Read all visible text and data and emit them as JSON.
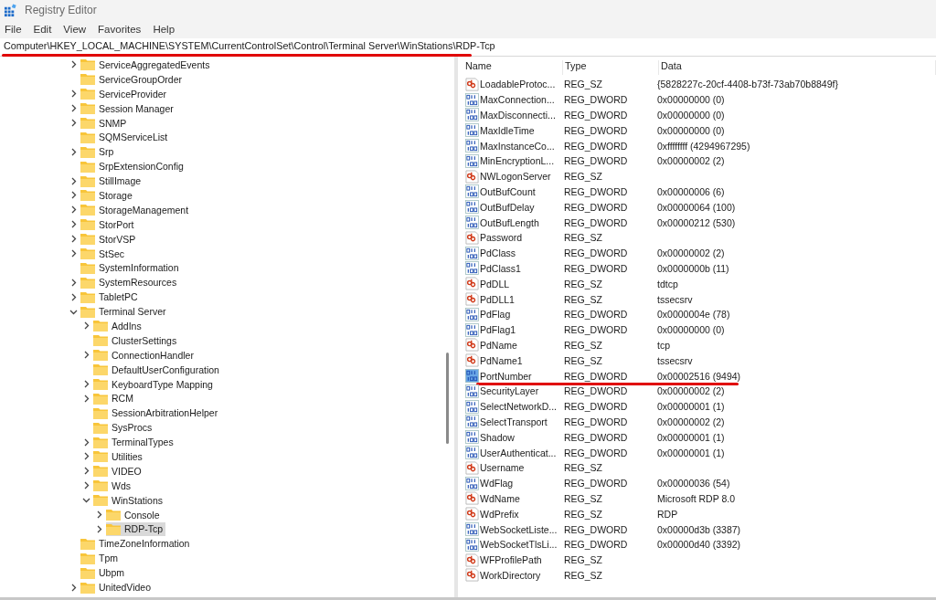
{
  "window": {
    "title": "Registry Editor"
  },
  "menu": [
    "File",
    "Edit",
    "View",
    "Favorites",
    "Help"
  ],
  "address": {
    "value": "Computer\\HKEY_LOCAL_MACHINE\\SYSTEM\\CurrentControlSet\\Control\\Terminal Server\\WinStations\\RDP-Tcp",
    "underlined": true
  },
  "tree": [
    {
      "label": "ServiceAggregatedEvents",
      "kind": "branch",
      "expanded": false,
      "selected": false
    },
    {
      "label": "ServiceGroupOrder",
      "kind": "leaf",
      "selected": false
    },
    {
      "label": "ServiceProvider",
      "kind": "branch",
      "expanded": false,
      "selected": false
    },
    {
      "label": "Session Manager",
      "kind": "branch",
      "expanded": false,
      "selected": false
    },
    {
      "label": "SNMP",
      "kind": "branch",
      "expanded": false,
      "selected": false
    },
    {
      "label": "SQMServiceList",
      "kind": "leaf",
      "selected": false
    },
    {
      "label": "Srp",
      "kind": "branch",
      "expanded": false,
      "selected": false
    },
    {
      "label": "SrpExtensionConfig",
      "kind": "leaf",
      "selected": false
    },
    {
      "label": "StillImage",
      "kind": "branch",
      "expanded": false,
      "selected": false
    },
    {
      "label": "Storage",
      "kind": "branch",
      "expanded": false,
      "selected": false
    },
    {
      "label": "StorageManagement",
      "kind": "branch",
      "expanded": false,
      "selected": false
    },
    {
      "label": "StorPort",
      "kind": "branch",
      "expanded": false,
      "selected": false
    },
    {
      "label": "StorVSP",
      "kind": "branch",
      "expanded": false,
      "selected": false
    },
    {
      "label": "StSec",
      "kind": "branch",
      "expanded": false,
      "selected": false
    },
    {
      "label": "SystemInformation",
      "kind": "leaf",
      "selected": false
    },
    {
      "label": "SystemResources",
      "kind": "branch",
      "expanded": false,
      "selected": false
    },
    {
      "label": "TabletPC",
      "kind": "branch",
      "expanded": false,
      "selected": false
    },
    {
      "label": "Terminal Server",
      "kind": "branch",
      "expanded": true,
      "selected": false,
      "children": [
        {
          "label": "AddIns",
          "kind": "branch",
          "expanded": false,
          "selected": false
        },
        {
          "label": "ClusterSettings",
          "kind": "leaf",
          "selected": false
        },
        {
          "label": "ConnectionHandler",
          "kind": "branch",
          "expanded": false,
          "selected": false
        },
        {
          "label": "DefaultUserConfiguration",
          "kind": "leaf",
          "selected": false
        },
        {
          "label": "KeyboardType Mapping",
          "kind": "branch",
          "expanded": false,
          "selected": false
        },
        {
          "label": "RCM",
          "kind": "branch",
          "expanded": false,
          "selected": false
        },
        {
          "label": "SessionArbitrationHelper",
          "kind": "leaf",
          "selected": false
        },
        {
          "label": "SysProcs",
          "kind": "leaf",
          "selected": false
        },
        {
          "label": "TerminalTypes",
          "kind": "branch",
          "expanded": false,
          "selected": false
        },
        {
          "label": "Utilities",
          "kind": "branch",
          "expanded": false,
          "selected": false
        },
        {
          "label": "VIDEO",
          "kind": "branch",
          "expanded": false,
          "selected": false
        },
        {
          "label": "Wds",
          "kind": "branch",
          "expanded": false,
          "selected": false
        },
        {
          "label": "WinStations",
          "kind": "branch",
          "expanded": true,
          "selected": false,
          "children": [
            {
              "label": "Console",
              "kind": "branch",
              "expanded": false,
              "selected": false
            },
            {
              "label": "RDP-Tcp",
              "kind": "branch",
              "expanded": false,
              "selected": true
            }
          ]
        }
      ]
    },
    {
      "label": "TimeZoneInformation",
      "kind": "leaf",
      "selected": false
    },
    {
      "label": "Tpm",
      "kind": "leaf",
      "selected": false
    },
    {
      "label": "Ubpm",
      "kind": "leaf",
      "selected": false
    },
    {
      "label": "UnitedVideo",
      "kind": "branch",
      "expanded": false,
      "selected": false
    }
  ],
  "values": {
    "columns": [
      "Name",
      "Type",
      "Data"
    ],
    "rows": [
      {
        "name": "LoadableProtoc...",
        "type": "REG_SZ",
        "data": "{5828227c-20cf-4408-b73f-73ab70b8849f}",
        "kind": "sz",
        "selected": false,
        "underlined": false
      },
      {
        "name": "MaxConnection...",
        "type": "REG_DWORD",
        "data": "0x00000000 (0)",
        "kind": "dword",
        "selected": false,
        "underlined": false
      },
      {
        "name": "MaxDisconnecti...",
        "type": "REG_DWORD",
        "data": "0x00000000 (0)",
        "kind": "dword",
        "selected": false,
        "underlined": false
      },
      {
        "name": "MaxIdleTime",
        "type": "REG_DWORD",
        "data": "0x00000000 (0)",
        "kind": "dword",
        "selected": false,
        "underlined": false
      },
      {
        "name": "MaxInstanceCo...",
        "type": "REG_DWORD",
        "data": "0xffffffff (4294967295)",
        "kind": "dword",
        "selected": false,
        "underlined": false
      },
      {
        "name": "MinEncryptionL...",
        "type": "REG_DWORD",
        "data": "0x00000002 (2)",
        "kind": "dword",
        "selected": false,
        "underlined": false
      },
      {
        "name": "NWLogonServer",
        "type": "REG_SZ",
        "kind": "sz",
        "selected": false,
        "underlined": false
      },
      {
        "name": "OutBufCount",
        "type": "REG_DWORD",
        "data": "0x00000006 (6)",
        "kind": "dword",
        "selected": false,
        "underlined": false
      },
      {
        "name": "OutBufDelay",
        "type": "REG_DWORD",
        "data": "0x00000064 (100)",
        "kind": "dword",
        "selected": false,
        "underlined": false
      },
      {
        "name": "OutBufLength",
        "type": "REG_DWORD",
        "data": "0x00000212 (530)",
        "kind": "dword",
        "selected": false,
        "underlined": false
      },
      {
        "name": "Password",
        "type": "REG_SZ",
        "kind": "sz",
        "selected": false,
        "underlined": false
      },
      {
        "name": "PdClass",
        "type": "REG_DWORD",
        "data": "0x00000002 (2)",
        "kind": "dword",
        "selected": false,
        "underlined": false
      },
      {
        "name": "PdClass1",
        "type": "REG_DWORD",
        "data": "0x0000000b (11)",
        "kind": "dword",
        "selected": false,
        "underlined": false
      },
      {
        "name": "PdDLL",
        "type": "REG_SZ",
        "data": "tdtcp",
        "kind": "sz",
        "selected": false,
        "underlined": false
      },
      {
        "name": "PdDLL1",
        "type": "REG_SZ",
        "data": "tssecsrv",
        "kind": "sz",
        "selected": false,
        "underlined": false
      },
      {
        "name": "PdFlag",
        "type": "REG_DWORD",
        "data": "0x0000004e (78)",
        "kind": "dword",
        "selected": false,
        "underlined": false
      },
      {
        "name": "PdFlag1",
        "type": "REG_DWORD",
        "data": "0x00000000 (0)",
        "kind": "dword",
        "selected": false,
        "underlined": false
      },
      {
        "name": "PdName",
        "type": "REG_SZ",
        "data": "tcp",
        "kind": "sz",
        "selected": false,
        "underlined": false
      },
      {
        "name": "PdName1",
        "type": "REG_SZ",
        "data": "tssecsrv",
        "kind": "sz",
        "selected": false,
        "underlined": false
      },
      {
        "name": "PortNumber",
        "type": "REG_DWORD",
        "data": "0x00002516 (9494)",
        "kind": "dword",
        "selected": true,
        "underlined": true
      },
      {
        "name": "SecurityLayer",
        "type": "REG_DWORD",
        "data": "0x00000002 (2)",
        "kind": "dword",
        "selected": false,
        "underlined": false
      },
      {
        "name": "SelectNetworkD...",
        "type": "REG_DWORD",
        "data": "0x00000001 (1)",
        "kind": "dword",
        "selected": false,
        "underlined": false
      },
      {
        "name": "SelectTransport",
        "type": "REG_DWORD",
        "data": "0x00000002 (2)",
        "kind": "dword",
        "selected": false,
        "underlined": false
      },
      {
        "name": "Shadow",
        "type": "REG_DWORD",
        "data": "0x00000001 (1)",
        "kind": "dword",
        "selected": false,
        "underlined": false
      },
      {
        "name": "UserAuthenticat...",
        "type": "REG_DWORD",
        "data": "0x00000001 (1)",
        "kind": "dword",
        "selected": false,
        "underlined": false
      },
      {
        "name": "Username",
        "type": "REG_SZ",
        "kind": "sz",
        "selected": false,
        "underlined": false
      },
      {
        "name": "WdFlag",
        "type": "REG_DWORD",
        "data": "0x00000036 (54)",
        "kind": "dword",
        "selected": false,
        "underlined": false
      },
      {
        "name": "WdName",
        "type": "REG_SZ",
        "data": "Microsoft RDP 8.0",
        "kind": "sz",
        "selected": false,
        "underlined": false
      },
      {
        "name": "WdPrefix",
        "type": "REG_SZ",
        "data": "RDP",
        "kind": "sz",
        "selected": false,
        "underlined": false
      },
      {
        "name": "WebSocketListe...",
        "type": "REG_DWORD",
        "data": "0x00000d3b (3387)",
        "kind": "dword",
        "selected": false,
        "underlined": false
      },
      {
        "name": "WebSocketTlsLi...",
        "type": "REG_DWORD",
        "data": "0x00000d40 (3392)",
        "kind": "dword",
        "selected": false,
        "underlined": false
      },
      {
        "name": "WFProfilePath",
        "type": "REG_SZ",
        "kind": "sz",
        "selected": false,
        "underlined": false
      },
      {
        "name": "WorkDirectory",
        "type": "REG_SZ",
        "kind": "sz",
        "selected": false,
        "underlined": false
      }
    ]
  }
}
